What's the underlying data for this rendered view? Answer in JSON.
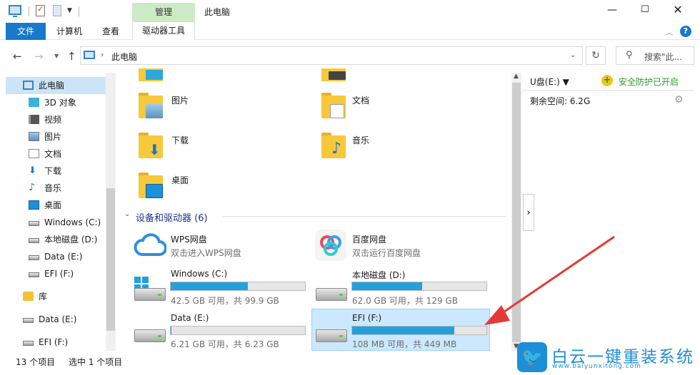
{
  "window": {
    "title": "此电脑",
    "manage_tab": "管理",
    "min": "—",
    "max": "☐",
    "close": "✕"
  },
  "ribbon": {
    "file": "文件",
    "computer": "计算机",
    "view": "查看",
    "drive_tools": "驱动器工具",
    "help": "?"
  },
  "address": {
    "path": "此电脑",
    "search_placeholder": "搜索\"此..."
  },
  "nav": {
    "items": [
      {
        "label": "此电脑",
        "icon": "computer-icon"
      },
      {
        "label": "3D 对象",
        "icon": "3d-objects-icon"
      },
      {
        "label": "视频",
        "icon": "video-icon"
      },
      {
        "label": "图片",
        "icon": "pictures-icon"
      },
      {
        "label": "文档",
        "icon": "documents-icon"
      },
      {
        "label": "下载",
        "icon": "downloads-icon"
      },
      {
        "label": "音乐",
        "icon": "music-icon"
      },
      {
        "label": "桌面",
        "icon": "desktop-icon"
      },
      {
        "label": "Windows (C:)",
        "icon": "drive-icon"
      },
      {
        "label": "本地磁盘 (D:)",
        "icon": "drive-icon"
      },
      {
        "label": "Data (E:)",
        "icon": "drive-icon"
      },
      {
        "label": "EFI (F:)",
        "icon": "drive-icon"
      },
      {
        "label": "库",
        "icon": "library-icon"
      },
      {
        "label": "Data (E:)",
        "icon": "drive-icon"
      },
      {
        "label": "EFI (F:)",
        "icon": "drive-icon"
      }
    ]
  },
  "folders": [
    {
      "label": "图片"
    },
    {
      "label": "文档"
    },
    {
      "label": "下载"
    },
    {
      "label": "音乐"
    },
    {
      "label": "桌面"
    }
  ],
  "devices": {
    "group_title": "设备和驱动器 (6)",
    "cloud": [
      {
        "name": "WPS网盘",
        "sub": "双击进入WPS网盘"
      },
      {
        "name": "百度网盘",
        "sub": "双击运行百度网盘"
      }
    ],
    "drives": [
      {
        "name": "Windows (C:)",
        "sub": "42.5 GB 可用，共 99.9 GB",
        "used": 0.575
      },
      {
        "name": "本地磁盘 (D:)",
        "sub": "62.0 GB 可用，共 129 GB",
        "used": 0.52
      },
      {
        "name": "Data (E:)",
        "sub": "6.21 GB 可用，共 6.23 GB",
        "used": 0.003
      },
      {
        "name": "EFI (F:)",
        "sub": "108 MB 可用，共 449 MB",
        "used": 0.76
      }
    ]
  },
  "right_pane": {
    "drive": "U盘(E:) ▼",
    "safe": "安全防护已开启",
    "free": "剩余空间: 6.2G"
  },
  "status": {
    "count": "13 个项目",
    "selected": "选中 1 个项目"
  },
  "watermark": {
    "cn": "白云一键重装系统",
    "url": "www.baiyunxitong.com"
  },
  "colors": {
    "accent": "#1979ca",
    "bar_fill": "#26a0da",
    "selection": "#cce8ff",
    "arrow": "#e53935"
  }
}
